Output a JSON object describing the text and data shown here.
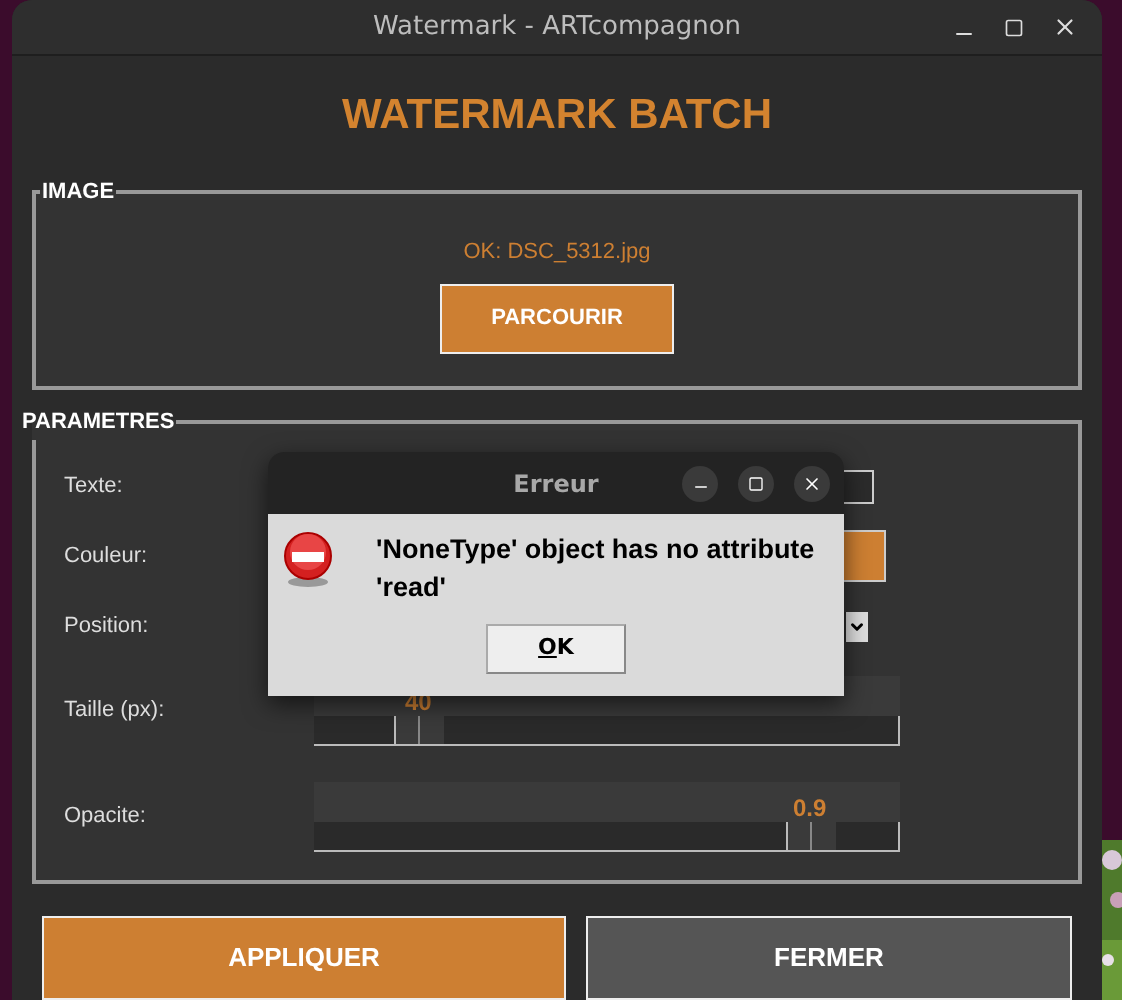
{
  "window": {
    "title": "Watermark - ARTcompagnon"
  },
  "heading": "WATERMARK BATCH",
  "image_section": {
    "legend": "IMAGE",
    "status": "OK: DSC_5312.jpg",
    "browse_button": "PARCOURIR"
  },
  "parameters": {
    "legend": "PARAMETRES",
    "fields": [
      {
        "kind": "text",
        "label": "Texte:"
      },
      {
        "kind": "color",
        "label": "Couleur:",
        "color": "#cd7f32"
      },
      {
        "kind": "dropdown",
        "label": "Position:"
      },
      {
        "kind": "slider",
        "label": "Taille (px):",
        "reading": "40",
        "level": 0.15
      },
      {
        "kind": "slider",
        "label": "Opacite:",
        "reading": "0.9",
        "level": 0.88
      }
    ]
  },
  "buttons": [
    {
      "label": "APPLIQUER",
      "kind": "primary"
    },
    {
      "label": "FERMER",
      "kind": "secondary"
    }
  ],
  "dialog": {
    "title": "Erreur",
    "message": "'NoneType' object has no attribute 'read'",
    "button": "OK"
  }
}
